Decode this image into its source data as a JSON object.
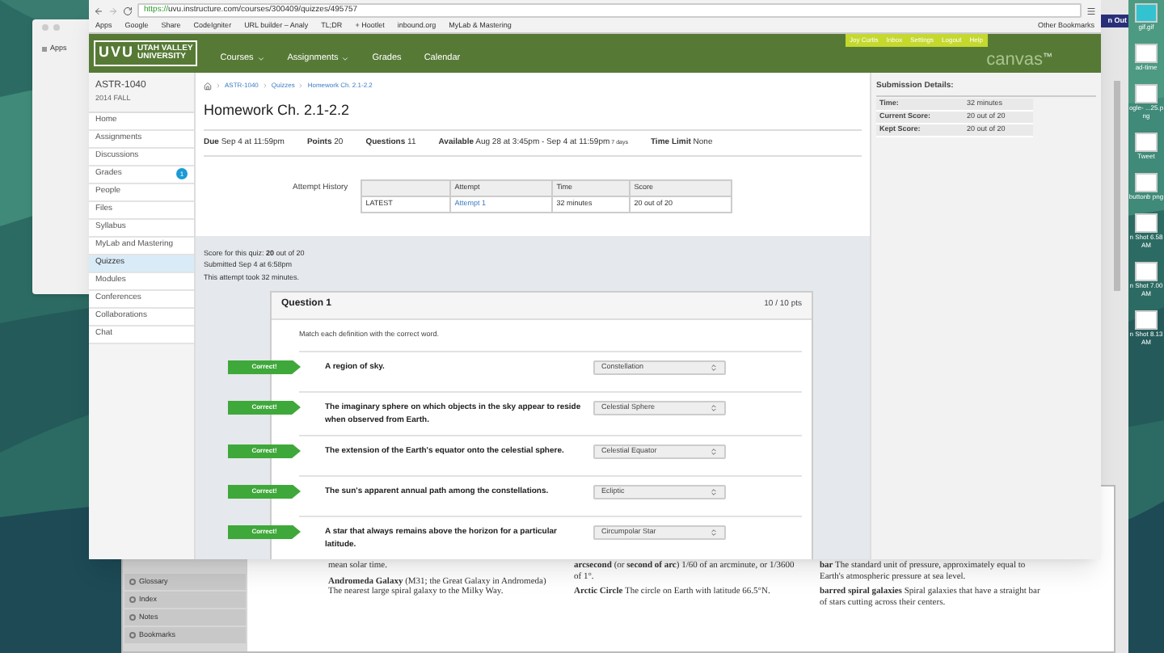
{
  "browser": {
    "url_secure": "https://",
    "url": "uvu.instructure.com/courses/300409/quizzes/495757",
    "bookmarks": [
      "Apps",
      "Google",
      "Share",
      "CodeIgniter",
      "URL builder – Analy",
      "TL;DR",
      "+ Hootlet",
      "inbound.org",
      "MyLab & Mastering"
    ],
    "other_bookmarks": "Other Bookmarks"
  },
  "canvas_header": {
    "logo": "UVU",
    "logo_sub_1": "UTAH VALLEY",
    "logo_sub_2": "UNIVERSITY",
    "nav": [
      {
        "label": "Courses",
        "dropdown": true
      },
      {
        "label": "Assignments",
        "dropdown": true
      },
      {
        "label": "Grades",
        "dropdown": false
      },
      {
        "label": "Calendar",
        "dropdown": false
      }
    ],
    "user_links": [
      "Joy Curtis",
      "Inbox",
      "Settings",
      "Logout",
      "Help"
    ],
    "brand": "canvas",
    "brand_mark": "™"
  },
  "sidebar": {
    "course": "ASTR-1040",
    "term": "2014 FALL",
    "items": [
      {
        "label": "Home",
        "selected": false
      },
      {
        "label": "Assignments",
        "selected": false
      },
      {
        "label": "Discussions",
        "selected": false
      },
      {
        "label": "Grades",
        "selected": false,
        "badge": "1"
      },
      {
        "label": "People",
        "selected": false
      },
      {
        "label": "Files",
        "selected": false
      },
      {
        "label": "Syllabus",
        "selected": false
      },
      {
        "label": "MyLab and Mastering",
        "selected": false
      },
      {
        "label": "Quizzes",
        "selected": true
      },
      {
        "label": "Modules",
        "selected": false
      },
      {
        "label": "Conferences",
        "selected": false
      },
      {
        "label": "Collaborations",
        "selected": false
      },
      {
        "label": "Chat",
        "selected": false
      }
    ]
  },
  "breadcrumb": [
    "ASTR-1040",
    "Quizzes",
    "Homework Ch. 2.1-2.2"
  ],
  "quiz": {
    "title": "Homework Ch. 2.1-2.2",
    "meta": [
      {
        "label": "Due",
        "value": "Sep 4 at 11:59pm"
      },
      {
        "label": "Points",
        "value": "20"
      },
      {
        "label": "Questions",
        "value": "11"
      },
      {
        "label": "Available",
        "value": "Aug 28 at 3:45pm - Sep 4 at 11:59pm",
        "note": "7 days"
      },
      {
        "label": "Time Limit",
        "value": "None"
      }
    ],
    "attempt_history": {
      "label": "Attempt History",
      "columns": [
        "Attempt",
        "Time",
        "Score"
      ],
      "rows": [
        {
          "name": "LATEST",
          "attempt": "Attempt 1",
          "time": "32 minutes",
          "score": "20 out of 20"
        }
      ]
    },
    "summary": [
      "Score for this quiz: **20** out of 20",
      "Submitted Sep 4 at 6:58pm",
      "This attempt took 32 minutes."
    ],
    "question": {
      "title": "Question 1",
      "points": "10 / 10 pts",
      "prompt": "Match each definition with the correct word.",
      "answers": [
        {
          "status": "Correct!",
          "correct": true,
          "definition": "A region of sky.",
          "choice": "Constellation"
        },
        {
          "status": "Correct!",
          "correct": true,
          "definition": "The imaginary sphere on which objects in the sky appear to reside when observed from Earth.",
          "choice": "Celestial Sphere"
        },
        {
          "status": "Correct!",
          "correct": true,
          "definition": "The extension of the Earth's equator onto the celestial sphere.",
          "choice": "Celestial Equator"
        },
        {
          "status": "Correct!",
          "correct": true,
          "definition": "The sun's apparent annual path among the constellations.",
          "choice": "Ecliptic"
        },
        {
          "status": "Correct!",
          "correct": true,
          "definition": "A star that always remains above the horizon for a particular latitude.",
          "choice": "Circumpolar Star"
        }
      ]
    }
  },
  "submission_details": {
    "title": "Submission Details:",
    "rows": [
      {
        "label": "Time:",
        "value": "32 minutes"
      },
      {
        "label": "Current Score:",
        "value": "20 out of 20"
      },
      {
        "label": "Kept Score:",
        "value": "20 out of 20"
      }
    ]
  },
  "back_window": {
    "sidebar": [
      "Glossary",
      "Index",
      "Notes",
      "Bookmarks"
    ],
    "columns": [
      [
        "mean solar time.",
        "**Andromeda Galaxy** (M31; the Great Galaxy in Andromeda) The nearest large spiral galaxy to the Milky Way."
      ],
      [
        "**arcsecond** (or **second of arc**) 1/60 of an arcminute, or 1/3600 of 1°.",
        "**Arctic Circle** The circle on Earth with latitude 66.5°N."
      ],
      [
        "**bar** The standard unit of pressure, approximately equal to Earth's atmospheric pressure at sea level.",
        "**barred spiral galaxies** Spiral galaxies that have a straight bar of stars cutting across their centers."
      ]
    ]
  },
  "left_window": {
    "bookmark": "Apps"
  },
  "right_window": {
    "tab": "n Out"
  },
  "desktop_icons": [
    {
      "label": "gif.gif"
    },
    {
      "label": "ad-time"
    },
    {
      "label": "ogle- ...25.png"
    },
    {
      "label": "Tweet"
    },
    {
      "label": "buttonb png"
    },
    {
      "label": "n Shot 6.58 AM"
    },
    {
      "label": "n Shot 7.00 AM"
    },
    {
      "label": "n Shot 8.13 AM"
    }
  ]
}
